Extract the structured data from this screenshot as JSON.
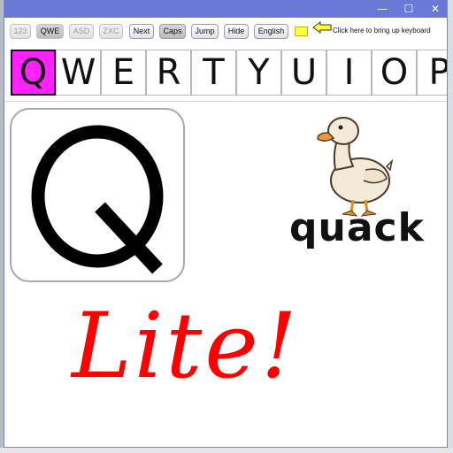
{
  "window": {
    "controls": {
      "minimize": "—",
      "maximize": "☐",
      "close": "✕"
    },
    "titlebar_color": "#6a78d6"
  },
  "toolbar": {
    "buttons": [
      {
        "label": "123",
        "state": "disabled"
      },
      {
        "label": "QWE",
        "state": "pressed-disabled"
      },
      {
        "label": "ASD",
        "state": "disabled"
      },
      {
        "label": "ZXC",
        "state": "disabled"
      },
      {
        "label": "Next",
        "state": "normal"
      },
      {
        "label": "Caps",
        "state": "active"
      },
      {
        "label": "Jump",
        "state": "normal"
      },
      {
        "label": "Hide",
        "state": "normal"
      },
      {
        "label": "English",
        "state": "normal"
      }
    ],
    "hint_text": "Click here to bring up keyboard",
    "hint_color": "#ffff33"
  },
  "keyboard": {
    "keys": [
      "Q",
      "W",
      "E",
      "R",
      "T",
      "Y",
      "U",
      "I",
      "O",
      "P"
    ],
    "selected": "Q",
    "selected_color": "#ff22ff"
  },
  "letter_card": {
    "letter": "Q",
    "icon": "letter-q-glyph"
  },
  "picture": {
    "icon": "duck-icon",
    "word": "quack"
  },
  "banner": {
    "text": "Lite!",
    "color": "#ff0000"
  }
}
